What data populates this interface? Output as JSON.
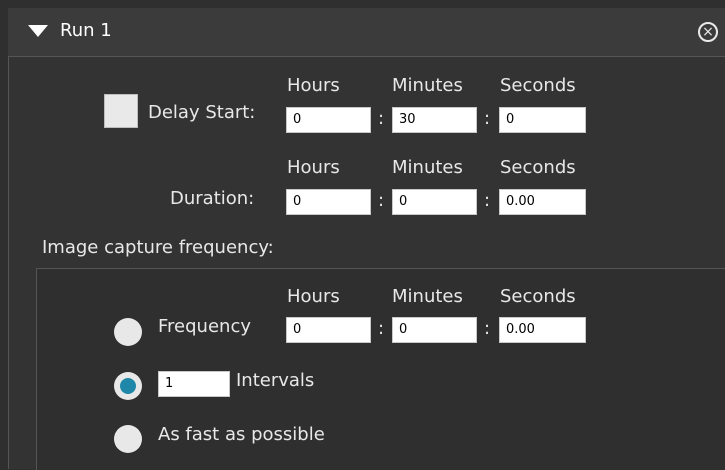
{
  "header": {
    "title": "Run 1",
    "collapse_icon": "triangle-down-icon",
    "close_icon": "close-circle-icon"
  },
  "columns": {
    "hours": "Hours",
    "minutes": "Minutes",
    "seconds": "Seconds"
  },
  "delay": {
    "label": "Delay Start:",
    "checked": false,
    "hours": "0",
    "minutes": "30",
    "seconds": "0"
  },
  "duration": {
    "label": "Duration:",
    "hours": "0",
    "minutes": "0",
    "seconds": "0.00"
  },
  "capture": {
    "label": "Image capture frequency:",
    "frequency": {
      "label": "Frequency",
      "selected": false,
      "hours": "0",
      "minutes": "0",
      "seconds": "0.00"
    },
    "intervals": {
      "label": "Intervals",
      "selected": true,
      "value": "1"
    },
    "fast": {
      "label": "As fast as possible",
      "selected": false
    }
  },
  "colors": {
    "accent": "#1f88a8",
    "panel": "#333333",
    "text": "#e8e8e8"
  }
}
